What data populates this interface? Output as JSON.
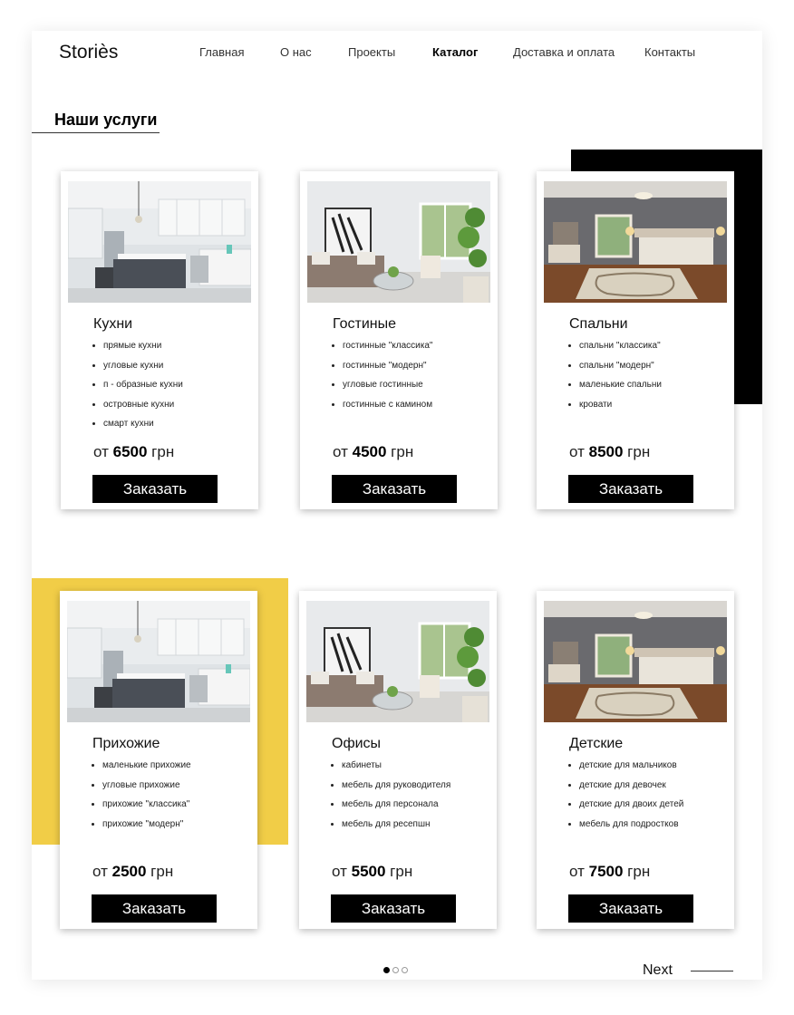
{
  "brand": {
    "logo": "Storiès"
  },
  "nav": {
    "items": [
      {
        "label": "Главная"
      },
      {
        "label": "О нас"
      },
      {
        "label": "Проекты"
      },
      {
        "label": "Каталог",
        "active": true
      },
      {
        "label": "Доставка и оплата"
      },
      {
        "label": "Контакты"
      }
    ]
  },
  "section": {
    "title": "Наши услуги"
  },
  "colors": {
    "accent_black": "#000000",
    "accent_yellow": "#f1cd47"
  },
  "cards": [
    {
      "title": "Кухни",
      "image": "kitchen-photo",
      "items": [
        "прямые кухни",
        "угловые кухни",
        "п - образные кухни",
        "островные кухни",
        "смарт кухни"
      ],
      "price_prefix": "от",
      "price": "6500",
      "currency": "грн",
      "button": "Заказать"
    },
    {
      "title": "Гостиные",
      "image": "living-room-photo",
      "items": [
        "гостинные \"классика\"",
        "гостинные \"модерн\"",
        "угловые гостинные",
        "гостинные с камином"
      ],
      "price_prefix": "от",
      "price": "4500",
      "currency": "грн",
      "button": "Заказать"
    },
    {
      "title": "Спальни",
      "image": "bedroom-photo",
      "items": [
        "спальни \"классика\"",
        "спальни \"модерн\"",
        "маленькие спальни",
        "кровати"
      ],
      "price_prefix": "от",
      "price": "8500",
      "currency": "грн",
      "button": "Заказать"
    },
    {
      "title": "Прихожие",
      "image": "kitchen-photo",
      "items": [
        "маленькие прихожие",
        "угловые прихожие",
        "прихожие \"классика\"",
        "прихожие \"модерн\""
      ],
      "price_prefix": "от",
      "price": "2500",
      "currency": "грн",
      "button": "Заказать"
    },
    {
      "title": "Офисы",
      "image": "living-room-photo",
      "items": [
        "кабинеты",
        "мебель для руководителя",
        "мебель для персонала",
        "мебель для ресепшн"
      ],
      "price_prefix": "от",
      "price": "5500",
      "currency": "грн",
      "button": "Заказать"
    },
    {
      "title": "Детские",
      "image": "bedroom-photo",
      "items": [
        "детские для мальчиков",
        "детские для девочек",
        "детские для двоих детей",
        "мебель для подростков"
      ],
      "price_prefix": "от",
      "price": "7500",
      "currency": "грн",
      "button": "Заказать"
    }
  ],
  "pagination": {
    "pages": 3,
    "current": 1
  },
  "next": {
    "label": "Next"
  }
}
